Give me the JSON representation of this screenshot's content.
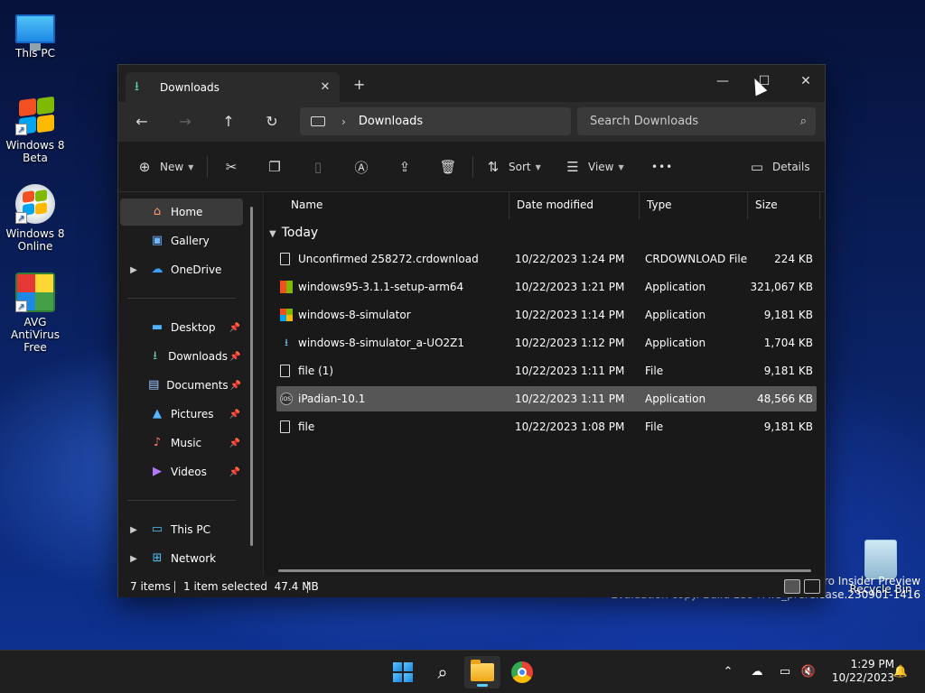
{
  "desktop": {
    "icons": [
      {
        "label": "This PC"
      },
      {
        "label": "Windows 8 Beta"
      },
      {
        "label": "Windows 8 Online"
      },
      {
        "label": "AVG AntiVirus Free"
      },
      {
        "label": "Recycle Bin"
      }
    ],
    "watermark": {
      "line1": "Windows 11 Pro Insider Preview",
      "line2": "Evaluation copy. Build 25947.rs_prerelease.230901-1416"
    }
  },
  "window": {
    "tab_title": "Downloads",
    "address": {
      "location": "Downloads"
    },
    "search_placeholder": "Search Downloads",
    "toolbar": {
      "new_label": "New",
      "sort_label": "Sort",
      "view_label": "View",
      "more_label": "•••",
      "details_label": "Details"
    },
    "sidebar": {
      "items": [
        {
          "label": "Home",
          "icon": "home-icon"
        },
        {
          "label": "Gallery",
          "icon": "gallery-icon"
        },
        {
          "label": "OneDrive",
          "icon": "cloud-icon"
        },
        {
          "label": "Desktop",
          "icon": "desktop-icon"
        },
        {
          "label": "Downloads",
          "icon": "download-icon"
        },
        {
          "label": "Documents",
          "icon": "documents-icon"
        },
        {
          "label": "Pictures",
          "icon": "pictures-icon"
        },
        {
          "label": "Music",
          "icon": "music-icon"
        },
        {
          "label": "Videos",
          "icon": "videos-icon"
        },
        {
          "label": "This PC",
          "icon": "pc-icon"
        },
        {
          "label": "Network",
          "icon": "network-icon"
        }
      ]
    },
    "columns": {
      "name": "Name",
      "date": "Date modified",
      "type": "Type",
      "size": "Size"
    },
    "group_label": "Today",
    "files": [
      {
        "name": "Unconfirmed 258272.crdownload",
        "date": "10/22/2023 1:24 PM",
        "type": "CRDOWNLOAD File",
        "size": "224 KB",
        "icon": "file-icon"
      },
      {
        "name": "windows95-3.1.1-setup-arm64",
        "date": "10/22/2023 1:21 PM",
        "type": "Application",
        "size": "321,067 KB",
        "icon": "windows95-app-icon"
      },
      {
        "name": "windows-8-simulator",
        "date": "10/22/2023 1:14 PM",
        "type": "Application",
        "size": "9,181 KB",
        "icon": "windows-flag-app-icon"
      },
      {
        "name": "windows-8-simulator_a-UO2Z1",
        "date": "10/22/2023 1:12 PM",
        "type": "Application",
        "size": "1,704 KB",
        "icon": "installer-app-icon"
      },
      {
        "name": "file (1)",
        "date": "10/22/2023 1:11 PM",
        "type": "File",
        "size": "9,181 KB",
        "icon": "file-icon"
      },
      {
        "name": "iPadian-10.1",
        "date": "10/22/2023 1:11 PM",
        "type": "Application",
        "size": "48,566 KB",
        "icon": "ios-app-icon",
        "ios_badge": "iOS"
      },
      {
        "name": "file",
        "date": "10/22/2023 1:08 PM",
        "type": "File",
        "size": "9,181 KB",
        "icon": "file-icon"
      }
    ],
    "status": {
      "count": "7 items",
      "selection": "1 item selected  47.4 MB"
    }
  },
  "taskbar": {
    "clock_time": "1:29 PM",
    "clock_date": "10/22/2023"
  }
}
